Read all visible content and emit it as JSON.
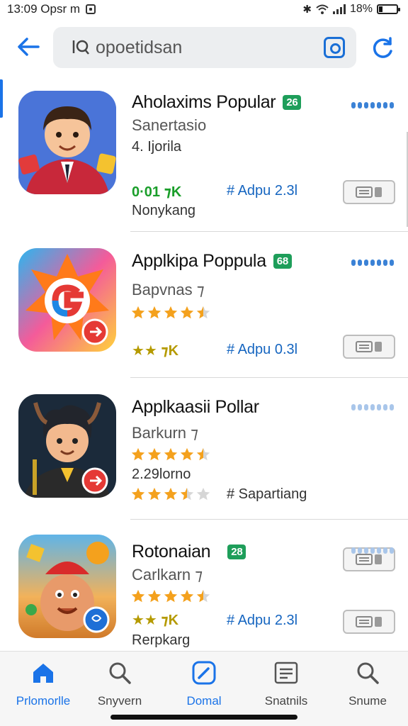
{
  "status_bar": {
    "time": "13:09 Opsr m",
    "battery": "18%"
  },
  "search": {
    "value": "opoetidsan"
  },
  "apps": [
    {
      "title": "Aholaxims Popular",
      "badge": "26",
      "subtitle": "Sanertasio",
      "line1": "4. Ijorila",
      "line2_left": "0·01 ⁊K",
      "line2_right": "# Adpu 2.3l",
      "line3": "Nonykang"
    },
    {
      "title": "Applkipa Poppula",
      "badge": "68",
      "subtitle": "Bapvnas ⁊",
      "rating": 4.5,
      "line2_left": "★★ ⁊K",
      "line2_right": "# Adpu 0.3l"
    },
    {
      "title": "Applkaasii Pollar",
      "subtitle": "Barkurn ⁊",
      "rating": 4.5,
      "line1": "2.29lorno",
      "rating2": 3.5,
      "line2_right": "# Sapartiang"
    },
    {
      "title": "Rotonaian",
      "badge": "28",
      "subtitle": "Carlkarn ⁊",
      "rating": 4.5,
      "line2_left": "★★ ⁊K",
      "line2_right": "# Adpu 2.3l",
      "line3": "Rerpkarg"
    }
  ],
  "bottom_nav": [
    {
      "label": "Prlomorlle",
      "icon": "home-icon",
      "active": true
    },
    {
      "label": "Snyvern",
      "icon": "search-icon",
      "active": false
    },
    {
      "label": "Domal",
      "icon": "edit-icon",
      "active": false
    },
    {
      "label": "Snatnils",
      "icon": "list-icon",
      "active": false
    },
    {
      "label": "Snume",
      "icon": "search-icon",
      "active": false
    }
  ],
  "colors": {
    "accent": "#1a73e8",
    "badge": "#1e9e5a",
    "star": "#f4a11d"
  }
}
